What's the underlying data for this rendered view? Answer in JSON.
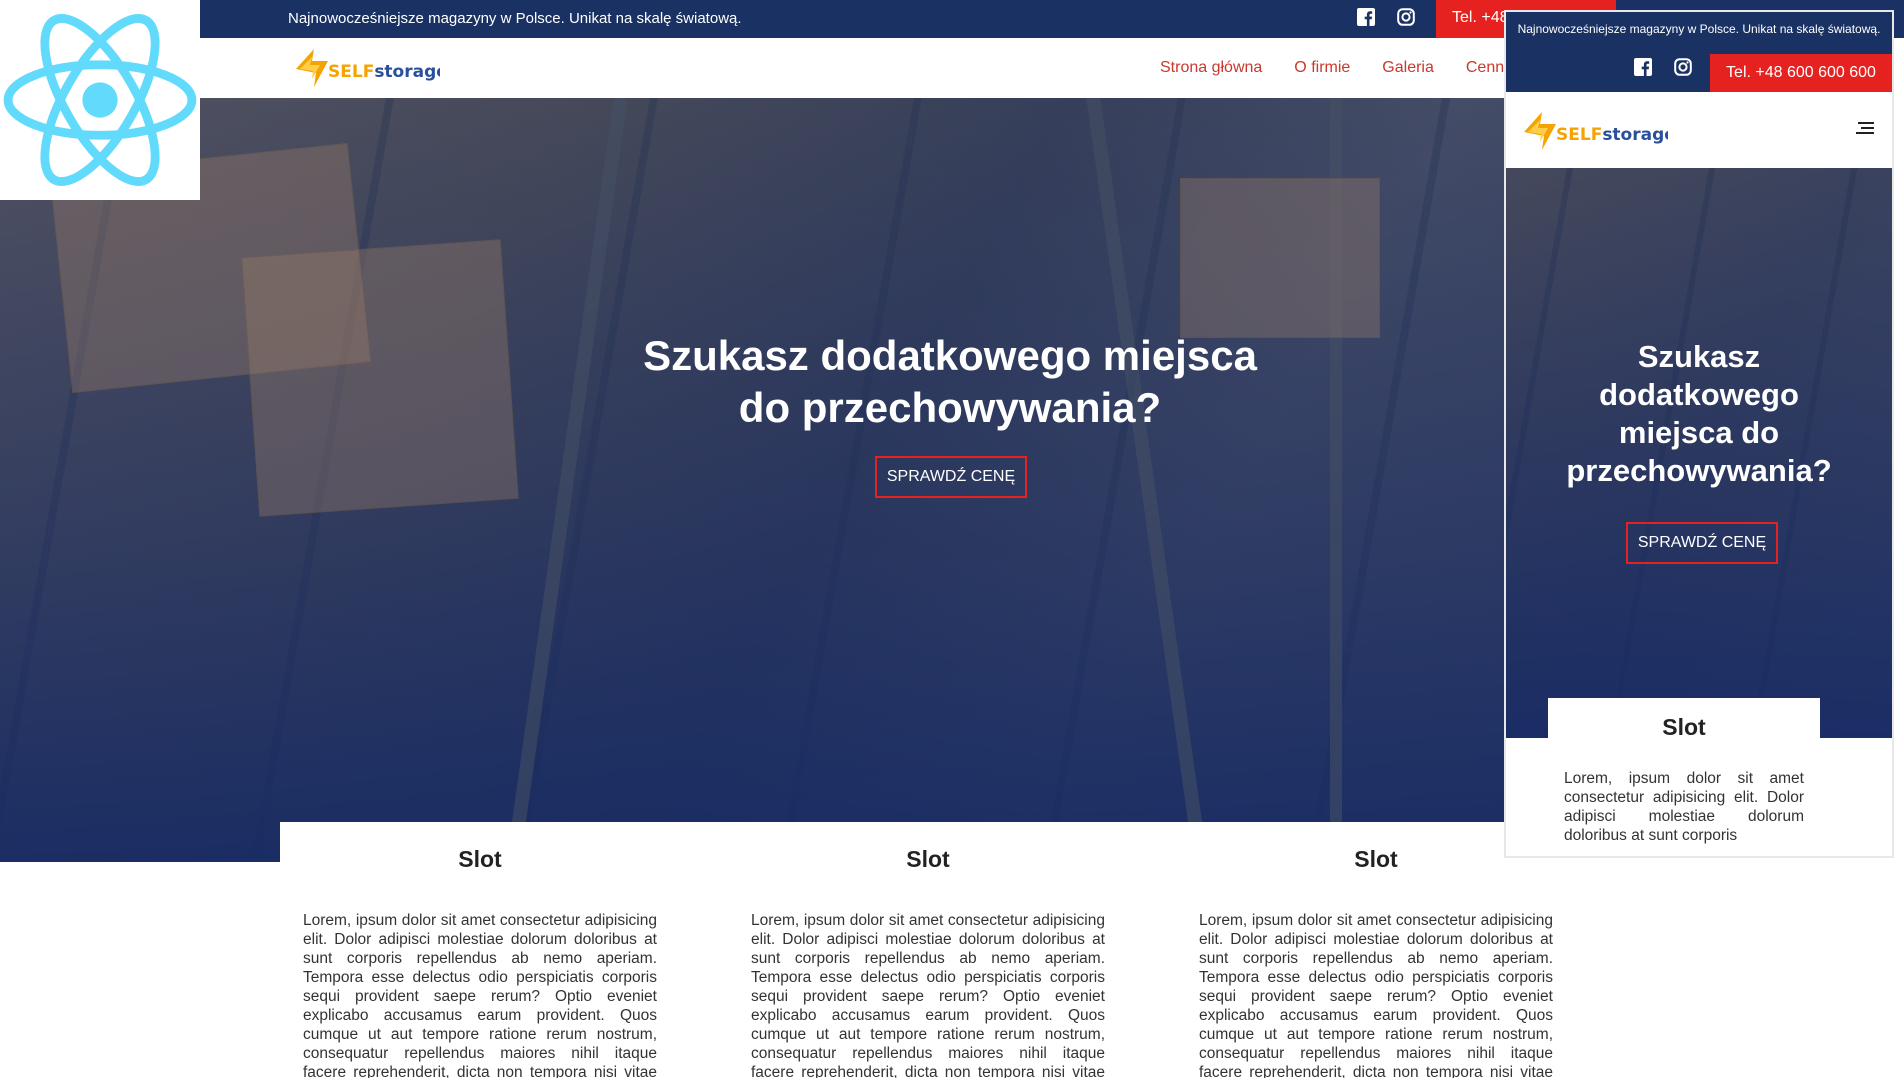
{
  "desktop": {
    "topbar": {
      "tagline": "Najnowocześniejsze magazyny w Polsce. Unikat na skalę światową.",
      "phone_partial": "Tel. +48"
    },
    "nav": {
      "logo_text": "SELFstorage",
      "menu": [
        "Strona główna",
        "O firmie",
        "Galeria",
        "Cenni"
      ]
    },
    "hero": {
      "headline": "Szukasz dodatkowego miejsca do przechowywania?",
      "cta": "SPRAWDŹ CENĘ"
    },
    "cards": [
      {
        "title": "Slot",
        "text": "Lorem, ipsum dolor sit amet consectetur adipisicing elit. Dolor adipisci molestiae dolorum doloribus at sunt corporis repellendus ab nemo aperiam. Tempora esse delectus odio perspiciatis corporis sequi provident saepe rerum? Optio eveniet explicabo accusamus earum provident. Quos cumque ut aut tempore ratione rerum nostrum, consequatur repellendus maiores nihil itaque facere reprehenderit, dicta non tempora nisi vitae molestiae voluptatum voluptates veritatis. Mollitia porro"
      },
      {
        "title": "Slot",
        "text": "Lorem, ipsum dolor sit amet consectetur adipisicing elit. Dolor adipisci molestiae dolorum doloribus at sunt corporis repellendus ab nemo aperiam. Tempora esse delectus odio perspiciatis corporis sequi provident saepe rerum? Optio eveniet explicabo accusamus earum provident. Quos cumque ut aut tempore ratione rerum nostrum, consequatur repellendus maiores nihil itaque facere reprehenderit, dicta non tempora nisi vitae molestiae voluptatum voluptates veritatis. Mollitia porro"
      },
      {
        "title": "Slot",
        "text": "Lorem, ipsum dolor sit amet consectetur adipisicing elit. Dolor adipisci molestiae dolorum doloribus at sunt corporis repellendus ab nemo aperiam. Tempora esse delectus odio perspiciatis corporis sequi provident saepe rerum? Optio eveniet explicabo accusamus earum provident. Quos cumque ut aut tempore ratione rerum nostrum, consequatur repellendus maiores nihil itaque facere reprehenderit, dicta non tempora nisi vitae molestiae voluptatum voluptates veritatis. Mollitia porro"
      }
    ]
  },
  "mobile": {
    "topbar": {
      "tagline": "Najnowocześniejsze magazyny w Polsce. Unikat na skalę światową.",
      "phone": "Tel. +48 600 600 600"
    },
    "nav": {
      "logo_text": "SELFstorage"
    },
    "hero": {
      "headline": "Szukasz dodatkowego miejsca do przechowywania?",
      "cta": "SPRAWDŹ CENĘ"
    },
    "card": {
      "title": "Slot",
      "text": "Lorem, ipsum dolor sit amet consectetur adipisicing elit. Dolor adipisci molestiae dolorum doloribus at sunt corporis"
    }
  },
  "icons": {
    "react": "react-logo-icon",
    "facebook": "facebook-icon",
    "instagram": "instagram-icon",
    "menu": "hamburger-menu-icon"
  },
  "colors": {
    "navy": "#1a3163",
    "red": "#e5221f",
    "nav_link": "#c8392f",
    "react": "#61dafb",
    "logo_orange": "#f5a300",
    "logo_blue": "#2a4f9c"
  }
}
